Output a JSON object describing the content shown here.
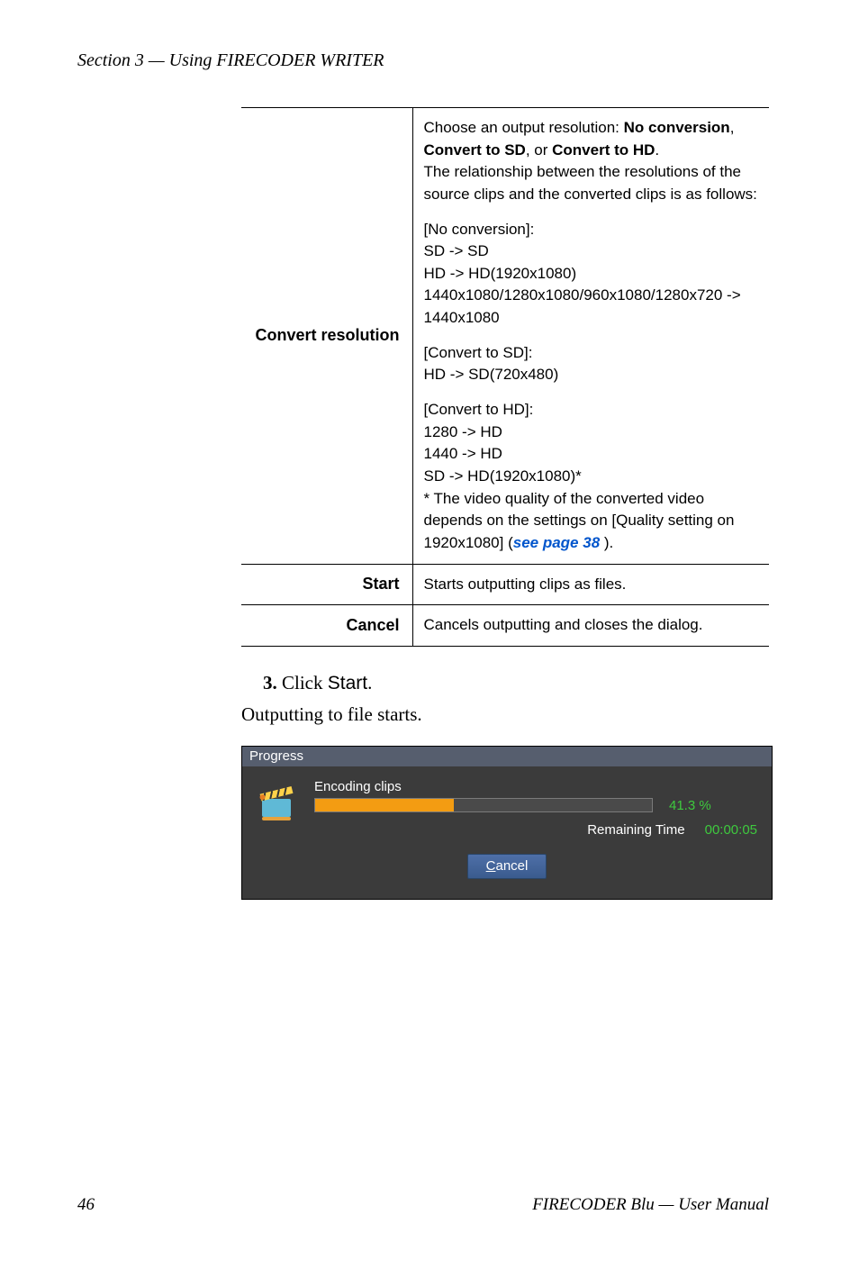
{
  "header": {
    "section": "Section 3 — Using FIRECODER WRITER"
  },
  "table": {
    "rows": [
      {
        "label": "Convert resolution",
        "p1_pre": "Choose an output resolution: ",
        "p1_b1": "No conversion",
        "p1_mid1": ", ",
        "p1_b2": "Convert to SD",
        "p1_mid2": ", or ",
        "p1_b3": "Convert to HD",
        "p1_suf": ".",
        "p1_line2": "The relationship between the resolutions of the source clips and the converted clips is as follows:",
        "p2_l1": "[No conversion]:",
        "p2_l2": "SD -> SD",
        "p2_l3": "HD -> HD(1920x1080)",
        "p2_l4": "1440x1080/1280x1080/960x1080/1280x720 -> 1440x1080",
        "p3_l1": "[Convert to SD]:",
        "p3_l2": "HD -> SD(720x480)",
        "p4_l1": "[Convert to HD]:",
        "p4_l2": "1280 -> HD",
        "p4_l3": "1440 -> HD",
        "p4_l4": "SD -> HD(1920x1080)*",
        "p4_l5": "* The video quality of the converted video depends on the settings on [Quality setting on 1920x1080] (",
        "p4_link": "see page 38",
        "p4_end": " )."
      },
      {
        "label": "Start",
        "desc": "Starts outputting clips as files."
      },
      {
        "label": "Cancel",
        "desc": "Cancels outputting and closes the dialog."
      }
    ]
  },
  "step": {
    "num": "3.",
    "pre": "  Click ",
    "sans": "Start",
    "suf": "."
  },
  "outputting": "Outputting to file starts.",
  "progress": {
    "title": "Progress",
    "label": "Encoding clips",
    "percent": "41.3 %",
    "remaining_label": "Remaining Time",
    "remaining_time": "00:00:05",
    "cancel_u": "C",
    "cancel_rest": "ancel"
  },
  "footer": {
    "page": "46",
    "right": "FIRECODER Blu  —  User Manual"
  }
}
